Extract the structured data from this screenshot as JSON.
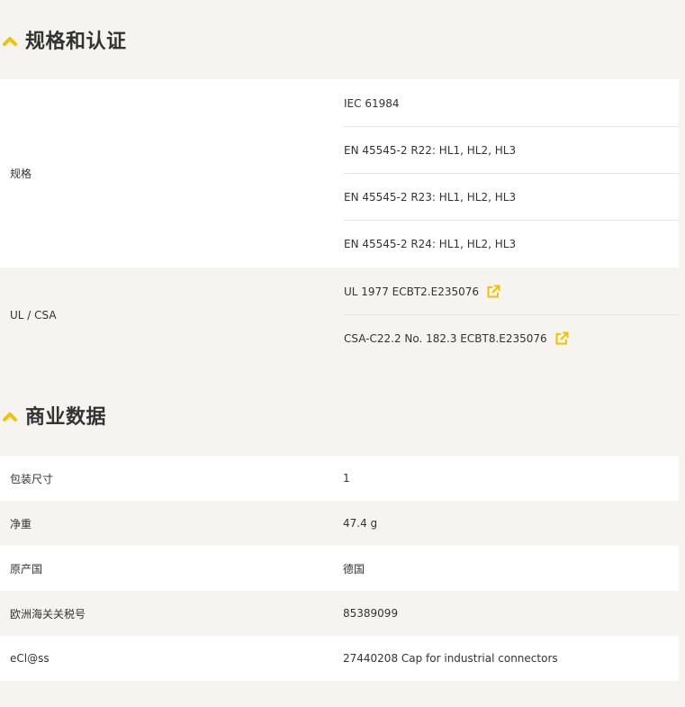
{
  "colors": {
    "accent": "#f2c200",
    "white_row": "#ffffff",
    "grey_row": "#f5f4f1",
    "divider": "#e3e3e3"
  },
  "spec_section": {
    "title": "规格和认证",
    "toggle_icon": "chevron-up-icon",
    "groups": [
      {
        "label": "规格",
        "values": [
          "IEC 61984",
          "EN 45545-2 R22: HL1, HL2, HL3",
          "EN 45545-2 R23: HL1, HL2, HL3",
          "EN 45545-2 R24: HL1, HL2, HL3"
        ]
      },
      {
        "label": "UL / CSA",
        "values": [
          "UL 1977 ECBT2.E235076",
          "CSA-C22.2 No. 182.3 ECBT8.E235076"
        ],
        "link_icon": "external-link-icon"
      }
    ]
  },
  "commercial_section": {
    "title": "商业数据",
    "toggle_icon": "chevron-up-icon",
    "rows": [
      {
        "label": "包装尺寸",
        "value": "1"
      },
      {
        "label": "净重",
        "value": "47.4 g"
      },
      {
        "label": "原产国",
        "value": "德国"
      },
      {
        "label": "欧洲海关关税号",
        "value": "85389099"
      },
      {
        "label": "eCl@ss",
        "value": "27440208 Cap for industrial connectors"
      }
    ]
  }
}
